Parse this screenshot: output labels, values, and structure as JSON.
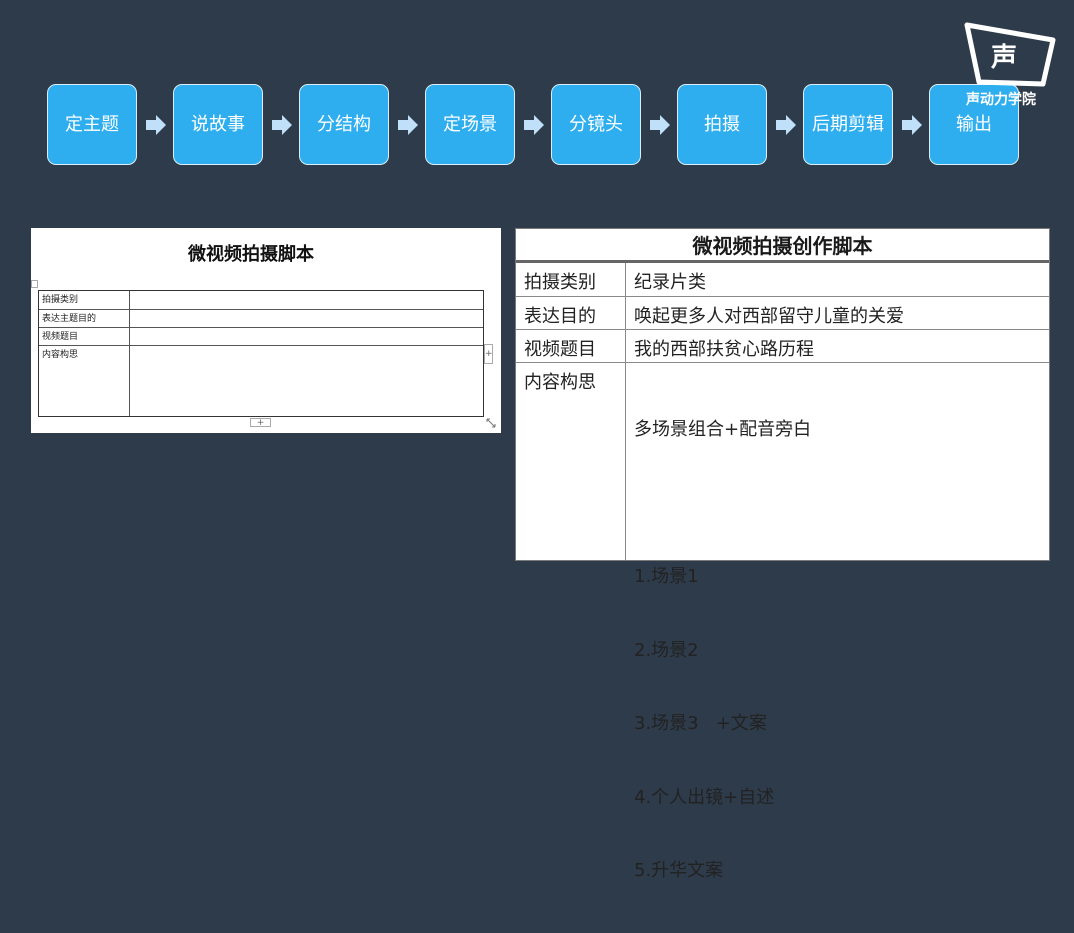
{
  "flow": {
    "steps": [
      "定主题",
      "说故事",
      "分结构",
      "定场景",
      "分镜头",
      "拍摄",
      "后期剪辑",
      "输出"
    ],
    "arrow_color": "#bfe0f8",
    "step_color": "#2eaeee"
  },
  "logo": {
    "glyph": "声",
    "text": "声动力学院"
  },
  "doc": {
    "title": "微视频拍摄脚本",
    "rows": [
      "拍摄类别",
      "表达主题目的",
      "视频题目",
      "内容构思"
    ],
    "add_handle": "+"
  },
  "script": {
    "title": "微视频拍摄创作脚本",
    "rows": [
      {
        "key": "拍摄类别",
        "value": "纪录片类"
      },
      {
        "key": "表达目的",
        "value": "唤起更多人对西部留守儿童的关爱"
      },
      {
        "key": "视频题目",
        "value": "我的西部扶贫心路历程"
      }
    ],
    "content": {
      "key": "内容构思",
      "lead": "多场景组合+配音旁白",
      "items": [
        "1.场景1",
        "2.场景2",
        "3.场景3   +文案",
        "4.个人出镜+自述",
        "5.升华文案"
      ]
    }
  }
}
